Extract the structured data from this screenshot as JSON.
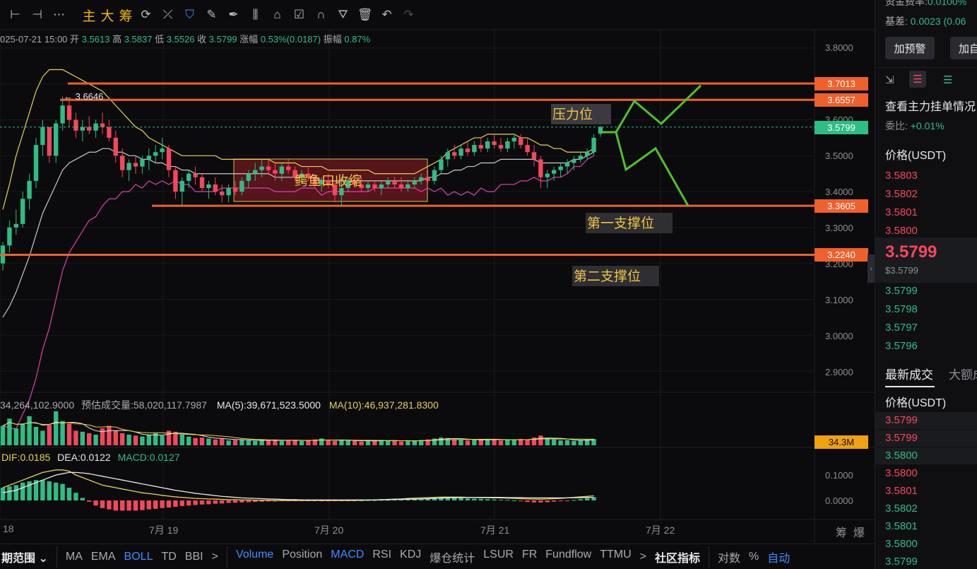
{
  "toolbar": {
    "icons": [
      "horizontal-line-icon",
      "horizontal-segment-icon",
      "more-dots-icon"
    ],
    "words": [
      "主",
      "大",
      "筹"
    ],
    "tools": [
      "sync-icon",
      "trend-tool-icon",
      "bookmark-icon",
      "ruler-icon",
      "pen-icon",
      "candles-icon",
      "lock-icon",
      "note-icon",
      "magnet-icon",
      "filter-icon",
      "trash-icon",
      "undo-icon",
      "redo-icon"
    ],
    "glyphs": {
      "horizontal-line-icon": "⊢",
      "horizontal-segment-icon": "⊣",
      "more-dots-icon": "⋯",
      "sync-icon": "⟳",
      "trend-tool-icon": "⤫",
      "bookmark-icon": "⛉",
      "ruler-icon": "✎",
      "pen-icon": "✒",
      "candles-icon": "⫼",
      "lock-icon": "⌂",
      "note-icon": "☑",
      "magnet-icon": "∩",
      "filter-icon": "⛛",
      "trash-icon": "🗑",
      "undo-icon": "↶",
      "redo-icon": "↷"
    }
  },
  "ohlc": {
    "datetime": "025-07-21 15:00",
    "open_label": "开",
    "open": "3.5613",
    "high_label": "高",
    "high": "3.5837",
    "low_label": "低",
    "low": "3.5526",
    "close_label": "收",
    "close": "3.5799",
    "change_label": "涨幅",
    "change": "0.53%(0.0187)",
    "amp_label": "振幅",
    "amp": "0.87%"
  },
  "price_axis": [
    "3.8000",
    "3.7000",
    "3.6000",
    "3.5000",
    "3.4000",
    "3.3000",
    "3.2000",
    "3.1000",
    "3.0000",
    "2.9000"
  ],
  "price_tags": [
    {
      "value": "3.7013",
      "color": "#f0602a"
    },
    {
      "value": "3.6557",
      "color": "#f0602a"
    },
    {
      "value": "3.5799",
      "color": "#2ebd85"
    },
    {
      "value": "3.3605",
      "color": "#f0602a"
    },
    {
      "value": "3.2240",
      "color": "#f0602a"
    }
  ],
  "annotations": {
    "resistance": "压力位",
    "support1": "第一支撑位",
    "support2": "第二支撑位",
    "squeeze": "鳄鱼口收缩",
    "high_marker": "← 3.6646"
  },
  "volume": {
    "vol_text": "34,264,102.9000",
    "est_label": "预估成交量:",
    "est_value": "58,020,117.7987",
    "ma5_label": "MA(5):",
    "ma5_value": "39,671,523.5000",
    "ma10_label": "MA(10):",
    "ma10_value": "46,937,281.8300",
    "tag": "34.3M"
  },
  "macd": {
    "dif_label": "DIF:",
    "dif": "0.0185",
    "dea_label": "DEA:",
    "dea": "0.0122",
    "macd_label": "MACD:",
    "macd": "0.0127",
    "axis": [
      "0.1000",
      "0.0000"
    ]
  },
  "time_axis": [
    "18",
    "7月 19",
    "7月 20",
    "7月 21",
    "7月 22"
  ],
  "time_axis_right": [
    "筹",
    "爆"
  ],
  "bottombar": {
    "range_label": "期范围",
    "indicators": [
      "MA",
      "EMA",
      "BOLL",
      "TD",
      "BBI"
    ],
    "more": ">",
    "sub_indicators": [
      "Volume",
      "Position",
      "MACD",
      "RSI",
      "KDJ",
      "爆仓统计",
      "LSUR",
      "FR",
      "Fundflow",
      "TTMU"
    ],
    "more2": ">",
    "community": "社区指标",
    "log": "对数",
    "percent": "%",
    "auto": "自动"
  },
  "right_panel": {
    "funding_label": "资金费率:",
    "funding_value": "0.0100%",
    "basis_label": "基差:",
    "basis_value": "0.0023 (0.06",
    "alert_button": "加预警",
    "custom_button": "加自",
    "orderbook_link": "查看主力挂单情况",
    "ratio_label": "委比:",
    "ratio_value": "+0.01%",
    "price_header": "价格(USDT)",
    "asks": [
      "3.5803",
      "3.5802",
      "3.5801",
      "3.5800"
    ],
    "last_price": "3.5799",
    "last_price_usd": "$3.5799",
    "bids": [
      "3.5799",
      "3.5798",
      "3.5797",
      "3.5796"
    ],
    "trades_tab": "最新成交",
    "large_tab": "大额成",
    "trades_header": "价格(USDT)",
    "trades": [
      {
        "p": "3.5799",
        "side": "ask"
      },
      {
        "p": "3.5799",
        "side": "ask"
      },
      {
        "p": "3.5800",
        "side": "bid"
      },
      {
        "p": "3.5800",
        "side": "ask"
      },
      {
        "p": "3.5801",
        "side": "ask"
      },
      {
        "p": "3.5802",
        "side": "bid"
      },
      {
        "p": "3.5801",
        "side": "bid"
      },
      {
        "p": "3.5800",
        "side": "bid"
      },
      {
        "p": "3.5799",
        "side": "bid"
      }
    ]
  },
  "colors": {
    "up": "#2ebd85",
    "down": "#f6465d",
    "accent": "#f0b90b",
    "level": "#f0602a",
    "blue": "#3f8cff",
    "boll_mid": "#c9c9c9",
    "boll_up": "#e8d44d",
    "boll_low": "#e040b0",
    "sketch": "#4fc22b"
  },
  "chart_data": {
    "type": "candlestick",
    "ylim": [
      2.85,
      3.83
    ],
    "candles": [
      [
        3.2,
        3.26,
        3.18,
        3.25
      ],
      [
        3.25,
        3.32,
        3.23,
        3.3
      ],
      [
        3.3,
        3.35,
        3.28,
        3.31
      ],
      [
        3.31,
        3.4,
        3.3,
        3.38
      ],
      [
        3.38,
        3.45,
        3.35,
        3.43
      ],
      [
        3.43,
        3.55,
        3.41,
        3.53
      ],
      [
        3.53,
        3.6,
        3.5,
        3.58
      ],
      [
        3.58,
        3.55,
        3.48,
        3.5
      ],
      [
        3.5,
        3.6,
        3.48,
        3.59
      ],
      [
        3.59,
        3.665,
        3.57,
        3.64
      ],
      [
        3.64,
        3.66,
        3.58,
        3.6
      ],
      [
        3.6,
        3.62,
        3.55,
        3.57
      ],
      [
        3.57,
        3.6,
        3.54,
        3.58
      ],
      [
        3.58,
        3.61,
        3.56,
        3.57
      ],
      [
        3.57,
        3.6,
        3.55,
        3.59
      ],
      [
        3.59,
        3.62,
        3.56,
        3.58
      ],
      [
        3.58,
        3.6,
        3.54,
        3.55
      ],
      [
        3.55,
        3.57,
        3.48,
        3.5
      ],
      [
        3.5,
        3.52,
        3.44,
        3.46
      ],
      [
        3.46,
        3.49,
        3.43,
        3.48
      ],
      [
        3.48,
        3.5,
        3.45,
        3.47
      ],
      [
        3.47,
        3.5,
        3.45,
        3.49
      ],
      [
        3.49,
        3.52,
        3.46,
        3.5
      ],
      [
        3.5,
        3.53,
        3.48,
        3.51
      ],
      [
        3.51,
        3.55,
        3.49,
        3.52
      ],
      [
        3.52,
        3.53,
        3.44,
        3.46
      ],
      [
        3.46,
        3.47,
        3.38,
        3.4
      ],
      [
        3.4,
        3.44,
        3.36,
        3.43
      ],
      [
        3.43,
        3.46,
        3.41,
        3.45
      ],
      [
        3.45,
        3.47,
        3.42,
        3.44
      ],
      [
        3.44,
        3.45,
        3.4,
        3.41
      ],
      [
        3.41,
        3.43,
        3.38,
        3.42
      ],
      [
        3.42,
        3.44,
        3.39,
        3.4
      ],
      [
        3.4,
        3.42,
        3.37,
        3.39
      ],
      [
        3.39,
        3.42,
        3.37,
        3.41
      ],
      [
        3.41,
        3.43,
        3.39,
        3.4
      ],
      [
        3.4,
        3.44,
        3.39,
        3.43
      ],
      [
        3.43,
        3.46,
        3.41,
        3.45
      ],
      [
        3.45,
        3.48,
        3.43,
        3.46
      ],
      [
        3.46,
        3.49,
        3.44,
        3.47
      ],
      [
        3.47,
        3.49,
        3.45,
        3.46
      ],
      [
        3.46,
        3.48,
        3.43,
        3.45
      ],
      [
        3.45,
        3.48,
        3.43,
        3.47
      ],
      [
        3.47,
        3.49,
        3.45,
        3.46
      ],
      [
        3.46,
        3.47,
        3.43,
        3.44
      ],
      [
        3.44,
        3.46,
        3.42,
        3.45
      ],
      [
        3.45,
        3.47,
        3.43,
        3.44
      ],
      [
        3.44,
        3.45,
        3.41,
        3.42
      ],
      [
        3.42,
        3.44,
        3.4,
        3.43
      ],
      [
        3.43,
        3.45,
        3.41,
        3.42
      ],
      [
        3.42,
        3.43,
        3.37,
        3.39
      ],
      [
        3.39,
        3.43,
        3.36,
        3.41
      ],
      [
        3.41,
        3.44,
        3.4,
        3.43
      ],
      [
        3.43,
        3.45,
        3.41,
        3.42
      ],
      [
        3.42,
        3.44,
        3.4,
        3.41
      ],
      [
        3.41,
        3.43,
        3.4,
        3.42
      ],
      [
        3.42,
        3.43,
        3.4,
        3.41
      ],
      [
        3.41,
        3.43,
        3.39,
        3.42
      ],
      [
        3.42,
        3.44,
        3.41,
        3.43
      ],
      [
        3.43,
        3.44,
        3.41,
        3.42
      ],
      [
        3.42,
        3.44,
        3.4,
        3.41
      ],
      [
        3.41,
        3.43,
        3.4,
        3.42
      ],
      [
        3.42,
        3.44,
        3.41,
        3.43
      ],
      [
        3.43,
        3.45,
        3.42,
        3.44
      ],
      [
        3.44,
        3.46,
        3.42,
        3.43
      ],
      [
        3.43,
        3.47,
        3.42,
        3.46
      ],
      [
        3.46,
        3.5,
        3.45,
        3.49
      ],
      [
        3.49,
        3.52,
        3.47,
        3.51
      ],
      [
        3.51,
        3.53,
        3.49,
        3.5
      ],
      [
        3.5,
        3.53,
        3.49,
        3.52
      ],
      [
        3.52,
        3.54,
        3.5,
        3.51
      ],
      [
        3.51,
        3.54,
        3.5,
        3.53
      ],
      [
        3.53,
        3.55,
        3.51,
        3.52
      ],
      [
        3.52,
        3.55,
        3.51,
        3.54
      ],
      [
        3.54,
        3.56,
        3.52,
        3.53
      ],
      [
        3.53,
        3.55,
        3.51,
        3.52
      ],
      [
        3.52,
        3.55,
        3.51,
        3.54
      ],
      [
        3.54,
        3.56,
        3.52,
        3.55
      ],
      [
        3.55,
        3.56,
        3.52,
        3.53
      ],
      [
        3.53,
        3.55,
        3.5,
        3.51
      ],
      [
        3.51,
        3.53,
        3.47,
        3.49
      ],
      [
        3.49,
        3.5,
        3.41,
        3.44
      ],
      [
        3.44,
        3.46,
        3.41,
        3.45
      ],
      [
        3.45,
        3.47,
        3.43,
        3.46
      ],
      [
        3.46,
        3.48,
        3.44,
        3.47
      ],
      [
        3.47,
        3.49,
        3.45,
        3.48
      ],
      [
        3.48,
        3.5,
        3.46,
        3.49
      ],
      [
        3.49,
        3.51,
        3.48,
        3.5
      ],
      [
        3.5,
        3.52,
        3.49,
        3.51
      ],
      [
        3.51,
        3.56,
        3.5,
        3.55
      ],
      [
        3.5613,
        3.5837,
        3.5526,
        3.5799
      ]
    ],
    "boll_mid": [
      3.05,
      3.08,
      3.12,
      3.17,
      3.22,
      3.28,
      3.34,
      3.38,
      3.42,
      3.46,
      3.48,
      3.49,
      3.5,
      3.51,
      3.51,
      3.52,
      3.52,
      3.51,
      3.51,
      3.5,
      3.5,
      3.49,
      3.49,
      3.48,
      3.48,
      3.47,
      3.47,
      3.46,
      3.46,
      3.45,
      3.45,
      3.45,
      3.45,
      3.45,
      3.45,
      3.45,
      3.45,
      3.45,
      3.45,
      3.45,
      3.45,
      3.44,
      3.44,
      3.44,
      3.44,
      3.44,
      3.44,
      3.44,
      3.43,
      3.43,
      3.43,
      3.43,
      3.43,
      3.43,
      3.43,
      3.43,
      3.43,
      3.43,
      3.43,
      3.43,
      3.43,
      3.43,
      3.43,
      3.43,
      3.44,
      3.44,
      3.45,
      3.45,
      3.46,
      3.46,
      3.47,
      3.47,
      3.48,
      3.48,
      3.48,
      3.49,
      3.49,
      3.49,
      3.49,
      3.49,
      3.49,
      3.48,
      3.48,
      3.48,
      3.48,
      3.48,
      3.49,
      3.49,
      3.5,
      3.51
    ],
    "boll_up": [
      3.35,
      3.42,
      3.5,
      3.56,
      3.62,
      3.68,
      3.72,
      3.74,
      3.74,
      3.74,
      3.73,
      3.72,
      3.71,
      3.7,
      3.69,
      3.68,
      3.66,
      3.64,
      3.62,
      3.6,
      3.58,
      3.57,
      3.55,
      3.54,
      3.53,
      3.52,
      3.51,
      3.5,
      3.5,
      3.5,
      3.5,
      3.5,
      3.5,
      3.49,
      3.49,
      3.49,
      3.49,
      3.49,
      3.49,
      3.49,
      3.49,
      3.48,
      3.48,
      3.48,
      3.48,
      3.47,
      3.47,
      3.47,
      3.47,
      3.46,
      3.46,
      3.46,
      3.46,
      3.46,
      3.46,
      3.46,
      3.45,
      3.45,
      3.45,
      3.45,
      3.45,
      3.45,
      3.45,
      3.46,
      3.47,
      3.48,
      3.49,
      3.51,
      3.52,
      3.53,
      3.54,
      3.55,
      3.55,
      3.56,
      3.56,
      3.56,
      3.56,
      3.56,
      3.55,
      3.55,
      3.54,
      3.53,
      3.53,
      3.52,
      3.52,
      3.51,
      3.51,
      3.51,
      3.51,
      3.52
    ],
    "boll_low": [
      2.75,
      2.74,
      2.74,
      2.78,
      2.82,
      2.88,
      2.96,
      3.02,
      3.1,
      3.18,
      3.23,
      3.26,
      3.29,
      3.32,
      3.33,
      3.36,
      3.38,
      3.38,
      3.4,
      3.4,
      3.42,
      3.41,
      3.43,
      3.42,
      3.43,
      3.42,
      3.43,
      3.42,
      3.42,
      3.4,
      3.4,
      3.4,
      3.4,
      3.41,
      3.41,
      3.41,
      3.41,
      3.41,
      3.41,
      3.41,
      3.41,
      3.4,
      3.4,
      3.4,
      3.4,
      3.41,
      3.41,
      3.41,
      3.39,
      3.4,
      3.4,
      3.4,
      3.4,
      3.4,
      3.4,
      3.4,
      3.41,
      3.41,
      3.41,
      3.41,
      3.41,
      3.41,
      3.41,
      3.4,
      3.41,
      3.4,
      3.41,
      3.39,
      3.4,
      3.39,
      3.4,
      3.39,
      3.41,
      3.4,
      3.4,
      3.42,
      3.42,
      3.42,
      3.43,
      3.43,
      3.44,
      3.43,
      3.43,
      3.44,
      3.44,
      3.45,
      3.47,
      3.47,
      3.49,
      3.5
    ],
    "volume": [
      40,
      55,
      35,
      45,
      60,
      38,
      30,
      42,
      70,
      50,
      45,
      30,
      28,
      25,
      22,
      35,
      40,
      30,
      25,
      22,
      20,
      18,
      22,
      25,
      20,
      30,
      28,
      22,
      18,
      15,
      16,
      14,
      12,
      13,
      10,
      11,
      12,
      10,
      9,
      11,
      10,
      12,
      9,
      10,
      11,
      9,
      10,
      12,
      14,
      10,
      9,
      11,
      10,
      9,
      8,
      10,
      9,
      11,
      10,
      9,
      8,
      10,
      9,
      11,
      12,
      14,
      16,
      15,
      12,
      11,
      10,
      12,
      11,
      13,
      12,
      10,
      11,
      12,
      13,
      12,
      16,
      20,
      14,
      12,
      10,
      11,
      9,
      10,
      12,
      13
    ],
    "macd_hist": [
      0.05,
      0.055,
      0.06,
      0.07,
      0.075,
      0.08,
      0.08,
      0.075,
      0.07,
      0.065,
      0.05,
      0.03,
      0.01,
      -0.005,
      -0.02,
      -0.03,
      -0.035,
      -0.04,
      -0.04,
      -0.04,
      -0.04,
      -0.038,
      -0.035,
      -0.033,
      -0.03,
      -0.028,
      -0.025,
      -0.022,
      -0.02,
      -0.018,
      -0.016,
      -0.015,
      -0.013,
      -0.012,
      -0.01,
      -0.009,
      -0.008,
      -0.007,
      -0.006,
      -0.005,
      -0.004,
      -0.004,
      -0.003,
      -0.003,
      -0.002,
      -0.002,
      -0.002,
      -0.002,
      -0.003,
      -0.003,
      -0.002,
      -0.002,
      -0.001,
      -0.001,
      0,
      0.001,
      0.001,
      0.002,
      0.002,
      0.003,
      0.003,
      0.004,
      0.005,
      0.006,
      0.007,
      0.008,
      0.009,
      0.009,
      0.01,
      0.009,
      0.008,
      0.007,
      0.006,
      0.005,
      0.004,
      0.003,
      0.002,
      0,
      -0.003,
      -0.006,
      -0.008,
      -0.008,
      -0.007,
      -0.005,
      -0.003,
      -0.001,
      0.002,
      0.005,
      0.009,
      0.0127
    ],
    "dif": [
      0.05,
      0.06,
      0.07,
      0.08,
      0.09,
      0.1,
      0.11,
      0.115,
      0.12,
      0.12,
      0.115,
      0.1,
      0.09,
      0.08,
      0.07,
      0.06,
      0.055,
      0.05,
      0.045,
      0.04,
      0.035,
      0.03,
      0.027,
      0.024,
      0.02,
      0.017,
      0.014,
      0.012,
      0.01,
      0.008,
      0.007,
      0.006,
      0.005,
      0.004,
      0.003,
      0.003,
      0.002,
      0.002,
      0.001,
      0.001,
      0.001,
      0,
      0,
      0,
      0,
      0,
      0,
      0,
      0,
      0,
      0,
      0,
      0,
      0,
      0.001,
      0.001,
      0.002,
      0.003,
      0.004,
      0.005,
      0.006,
      0.008,
      0.009,
      0.01,
      0.011,
      0.012,
      0.013,
      0.013,
      0.013,
      0.013,
      0.012,
      0.012,
      0.011,
      0.011,
      0.01,
      0.01,
      0.009,
      0.008,
      0.007,
      0.006,
      0.005,
      0.005,
      0.006,
      0.007,
      0.008,
      0.01,
      0.012,
      0.014,
      0.016,
      0.0185
    ],
    "dea": [
      0.03,
      0.035,
      0.04,
      0.05,
      0.06,
      0.07,
      0.08,
      0.09,
      0.1,
      0.105,
      0.11,
      0.11,
      0.108,
      0.105,
      0.1,
      0.095,
      0.09,
      0.085,
      0.08,
      0.075,
      0.07,
      0.065,
      0.06,
      0.055,
      0.05,
      0.045,
      0.04,
      0.036,
      0.032,
      0.028,
      0.025,
      0.022,
      0.019,
      0.016,
      0.014,
      0.012,
      0.01,
      0.009,
      0.008,
      0.007,
      0.006,
      0.005,
      0.004,
      0.003,
      0.003,
      0.002,
      0.002,
      0.002,
      0.002,
      0.002,
      0.002,
      0.002,
      0.002,
      0.002,
      0.002,
      0.002,
      0.002,
      0.003,
      0.003,
      0.004,
      0.004,
      0.005,
      0.005,
      0.006,
      0.007,
      0.008,
      0.009,
      0.01,
      0.011,
      0.011,
      0.012,
      0.012,
      0.012,
      0.012,
      0.012,
      0.012,
      0.011,
      0.011,
      0.011,
      0.01,
      0.01,
      0.01,
      0.01,
      0.01,
      0.01,
      0.01,
      0.011,
      0.011,
      0.012,
      0.0122
    ]
  }
}
